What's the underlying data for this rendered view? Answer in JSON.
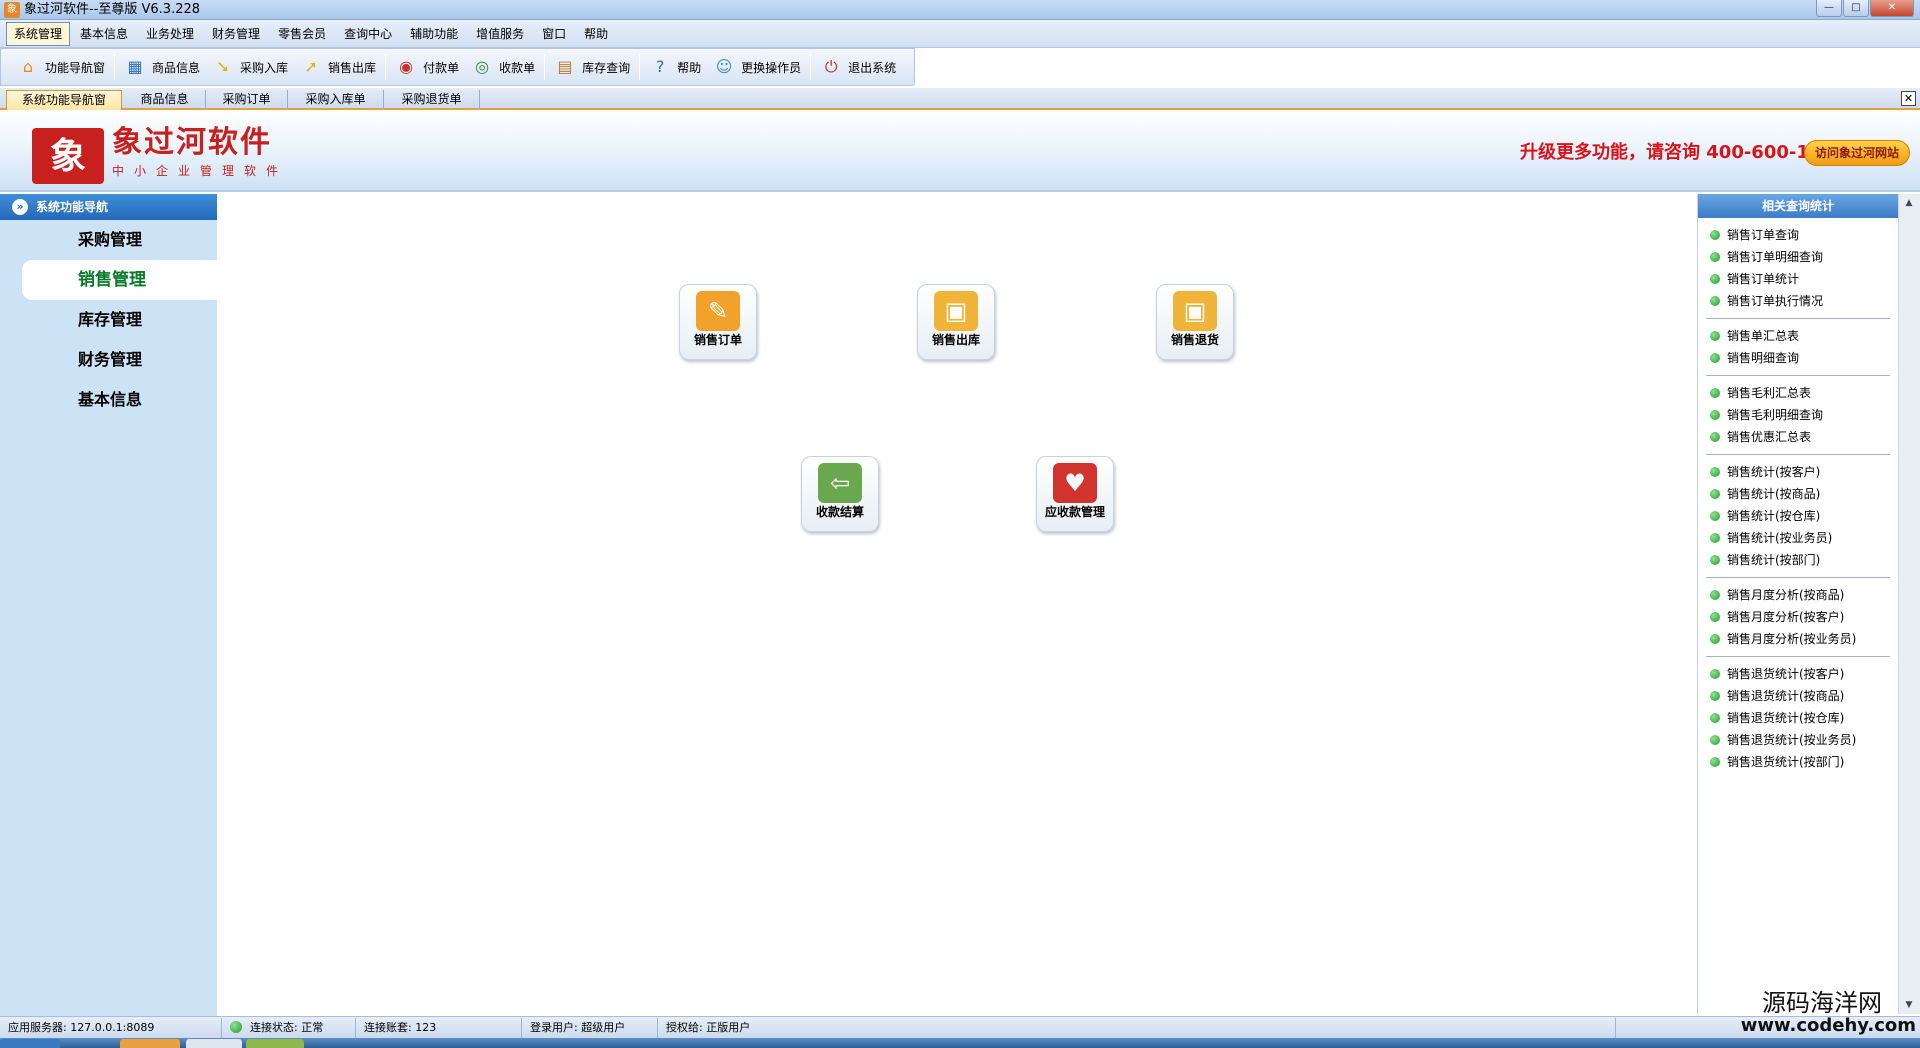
{
  "window": {
    "title": "象过河软件--至尊版 V6.3.228",
    "app_icon_glyph": "象",
    "buttons": {
      "minimize": "—",
      "maximize": "□",
      "close": "✕"
    }
  },
  "menubar": {
    "items": [
      "系统管理",
      "基本信息",
      "业务处理",
      "财务管理",
      "零售会员",
      "查询中心",
      "辅助功能",
      "增值服务",
      "窗口",
      "帮助"
    ],
    "active_index": 0
  },
  "toolbar": {
    "buttons": [
      {
        "label": "功能导航窗",
        "icon": "home-icon",
        "glyph": "⌂",
        "color": "#e48a1e"
      },
      {
        "label": "商品信息",
        "icon": "grid-icon",
        "glyph": "▦",
        "color": "#2e6fb8"
      },
      {
        "label": "采购入库",
        "icon": "folder-arrow-in-icon",
        "glyph": "➘",
        "color": "#d8b21a"
      },
      {
        "label": "销售出库",
        "icon": "folder-arrow-out-icon",
        "glyph": "➚",
        "color": "#d8b21a"
      },
      {
        "label": "付款单",
        "icon": "payment-icon",
        "glyph": "◉",
        "color": "#c8322a"
      },
      {
        "label": "收款单",
        "icon": "receipt-icon",
        "glyph": "◎",
        "color": "#2a8a3a"
      },
      {
        "label": "库存查询",
        "icon": "inventory-icon",
        "glyph": "▤",
        "color": "#b8792a"
      },
      {
        "label": "帮助",
        "icon": "help-icon",
        "glyph": "?",
        "color": "#2e6fb8"
      },
      {
        "label": "更换操作员",
        "icon": "users-icon",
        "glyph": "☺",
        "color": "#3a86c8"
      },
      {
        "label": "退出系统",
        "icon": "exit-icon",
        "glyph": "⏻",
        "color": "#d0302a"
      }
    ]
  },
  "tabs": {
    "items": [
      "系统功能导航窗",
      "商品信息",
      "采购订单",
      "采购入库单",
      "采购退货单"
    ],
    "active_index": 0,
    "close_glyph": "✕"
  },
  "banner": {
    "logo_glyph": "象",
    "brand": "象过河软件",
    "tagline": "中小企业管理软件",
    "promo": "升级更多功能，请咨询 400-600-1168",
    "visit_button": "访问象过河网站"
  },
  "leftnav": {
    "title": "系统功能导航",
    "chevron_glyph": "»",
    "items": [
      "采购管理",
      "销售管理",
      "库存管理",
      "财务管理",
      "基本信息"
    ],
    "active_index": 1
  },
  "main": {
    "features": [
      {
        "label": "销售订单",
        "icon": "sales-order-icon",
        "glyph": "✎",
        "color": "#f2a12a"
      },
      {
        "label": "销售出库",
        "icon": "sales-outbound-icon",
        "glyph": "▣",
        "color": "#f0b43a"
      },
      {
        "label": "销售退货",
        "icon": "sales-return-icon",
        "glyph": "▣",
        "color": "#f0b43a"
      },
      {
        "label": "收款结算",
        "icon": "payment-settlement-icon",
        "glyph": "⇦",
        "color": "#6aa84f"
      },
      {
        "label": "应收款管理",
        "icon": "receivables-icon",
        "glyph": "♥",
        "color": "#d0342c"
      }
    ]
  },
  "rightpanel": {
    "title": "相关查询统计",
    "groups": [
      [
        "销售订单查询",
        "销售订单明细查询",
        "销售订单统计",
        "销售订单执行情况"
      ],
      [
        "销售单汇总表",
        "销售明细查询"
      ],
      [
        "销售毛利汇总表",
        "销售毛利明细查询",
        "销售优惠汇总表"
      ],
      [
        "销售统计(按客户)",
        "销售统计(按商品)",
        "销售统计(按仓库)",
        "销售统计(按业务员)",
        "销售统计(按部门)"
      ],
      [
        "销售月度分析(按商品)",
        "销售月度分析(按客户)",
        "销售月度分析(按业务员)"
      ],
      [
        "销售退货统计(按客户)",
        "销售退货统计(按商品)",
        "销售退货统计(按仓库)",
        "销售退货统计(按业务员)",
        "销售退货统计(按部门)"
      ]
    ]
  },
  "scroll": {
    "up_glyph": "▲",
    "down_glyph": "▼"
  },
  "statusbar": {
    "server": "应用服务器: 127.0.0.1:8089",
    "connection": "连接状态: 正常",
    "account": "连接账套: 123",
    "user": "登录用户: 超级用户",
    "license": "授权给: 正版用户"
  },
  "watermark": {
    "line1": "源码海洋网",
    "line2": "www.codehy.com"
  },
  "colors": {
    "accent": "#2369b8",
    "brand_red": "#c8201e",
    "active_green": "#0a7a2a",
    "tab_orange": "#e6a23a"
  }
}
